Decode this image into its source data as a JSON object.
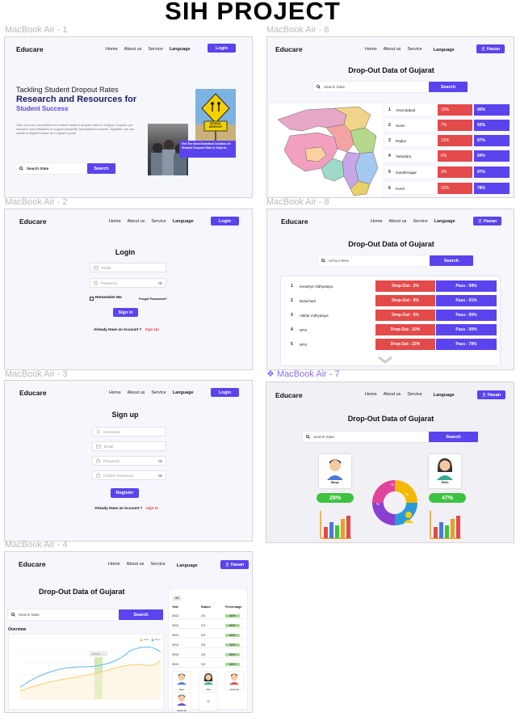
{
  "page_title": "SIH PROJECT",
  "colors": {
    "accent": "#5b43ee",
    "danger": "#e34a4a",
    "success": "#3ec23e"
  },
  "common": {
    "logo": "Educare",
    "nav": [
      "Home",
      "About us",
      "Service"
    ],
    "language": "Language",
    "login": "Login",
    "user": "Hasan",
    "search_button": "Search",
    "search_placeholder": "Search State",
    "dropout_title": "Drop-Out Data of Gujarat"
  },
  "frame1": {
    "label": "MacBook Air - 1",
    "tagline": "Tackling Student Dropout Rates",
    "headline": "Research and Resources for",
    "subheadline": "Student Success",
    "body": "Join us in our commitment to reduce student dropout rates in Gujarat. Explore our research and initiatives to support students' educational success. Together, we can create a brighter future for Gujarat's youth.",
    "search_placeholder": "Search State",
    "search_button": "Search",
    "card_text": "Get The Best Statistical Solution Of Student Dropout Rate In Gujarat.",
    "sign_text": "SCHOOL DROPOUT"
  },
  "frame2": {
    "label": "MacBook Air - 2",
    "heading": "Login",
    "email_placeholder": "Email",
    "password_placeholder": "Password",
    "remember": "Remember Me",
    "forgot": "Forget Password?",
    "button": "Sign in",
    "already": "Already Have an Account ?",
    "link": "Sign Up"
  },
  "frame3": {
    "label": "MacBook Air - 3",
    "heading": "Sign up",
    "username_placeholder": "Username",
    "email_placeholder": "Email",
    "password_placeholder": "Password",
    "confirm_placeholder": "Confirm Password",
    "button": "Register",
    "already": "Already Have an Account ?",
    "link": "Sign In"
  },
  "frame4": {
    "label": "MacBook Air - 4",
    "overview": "Overview",
    "tab_all": "All",
    "table_headers": [
      "Year",
      "Ration",
      "Percentage"
    ],
    "table_rows": [
      {
        "year": "2013",
        "ratio": "3:5",
        "pct": "60%"
      },
      {
        "year": "2013",
        "ratio": "3:9",
        "pct": "60%"
      },
      {
        "year": "2013",
        "ratio": "3:5",
        "pct": "60%"
      },
      {
        "year": "2013",
        "ratio": "3:5",
        "pct": "60%"
      },
      {
        "year": "2013",
        "ratio": "3:5",
        "pct": "60%"
      },
      {
        "year": "2013",
        "ratio": "3:5",
        "pct": "60%"
      }
    ],
    "avatars": [
      "Boys",
      "Girls",
      "Under 18",
      "Above 18"
    ],
    "add": "+",
    "legend": [
      "Girls",
      "Boys"
    ],
    "tooltip": "Results"
  },
  "frame6": {
    "label": "MacBook Air - 6",
    "rows": [
      {
        "rank": "1",
        "name": "Ahemdabad",
        "dropout": "10%",
        "pass": "90%"
      },
      {
        "rank": "2",
        "name": "Surat",
        "dropout": "7%",
        "pass": "93%"
      },
      {
        "rank": "3",
        "name": "Rajkot",
        "dropout": "13%",
        "pass": "87%"
      },
      {
        "rank": "4",
        "name": "Vadodara",
        "dropout": "6%",
        "pass": "94%"
      },
      {
        "rank": "5",
        "name": "Gandhinagar",
        "dropout": "3%",
        "pass": "97%"
      },
      {
        "rank": "6",
        "name": "Kutch",
        "dropout": "22%",
        "pass": "78%"
      }
    ]
  },
  "frame7": {
    "label": "MacBook Air - 7",
    "boys_label": "Boys",
    "girls_label": "Girls",
    "boys_pct": "29%",
    "girls_pct": "47%",
    "donut_labels": [
      "%",
      "%",
      "%"
    ]
  },
  "frame8": {
    "label": "MacBook Air - 8",
    "search_placeholder": "School Wise",
    "rows": [
      {
        "rank": "1",
        "name": "Kendriya Vidhyalaya",
        "dropout": "Drop-Out - 2%",
        "pass": "Pass - 98%"
      },
      {
        "rank": "2",
        "name": "Bolachadi",
        "dropout": "Drop-Out - 9%",
        "pass": "Pass - 91%"
      },
      {
        "rank": "3",
        "name": "Vitthal Vidhyalaya",
        "dropout": "Drop-Out - 5%",
        "pass": "Pass - 95%"
      },
      {
        "rank": "4",
        "name": "DPS",
        "dropout": "Drop-Out - 10%",
        "pass": "Pass - 90%"
      },
      {
        "rank": "5",
        "name": "DPS",
        "dropout": "Drop-Out - 22%",
        "pass": "Pass - 78%"
      }
    ]
  }
}
